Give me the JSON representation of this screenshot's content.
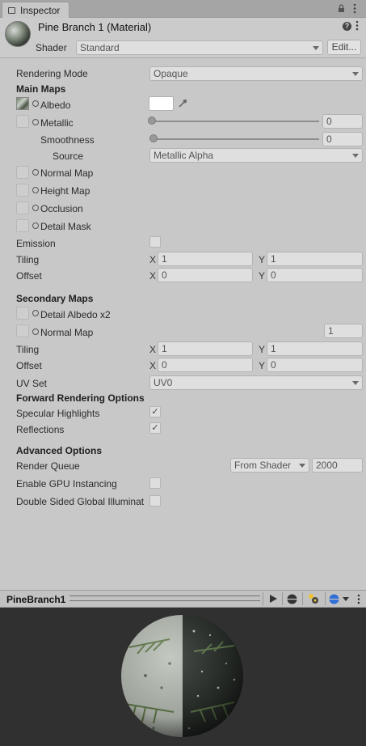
{
  "tab": {
    "title": "Inspector"
  },
  "header": {
    "material_name": "Pine Branch 1 (Material)",
    "shader_label": "Shader",
    "shader_value": "Standard",
    "edit_label": "Edit..."
  },
  "rendering_mode": {
    "label": "Rendering Mode",
    "value": "Opaque"
  },
  "main_maps": {
    "title": "Main Maps",
    "albedo": "Albedo",
    "metallic": {
      "label": "Metallic",
      "value": "0"
    },
    "smoothness": {
      "label": "Smoothness",
      "value": "0"
    },
    "source": {
      "label": "Source",
      "value": "Metallic Alpha"
    },
    "normal_map": "Normal Map",
    "height_map": "Height Map",
    "occlusion": "Occlusion",
    "detail_mask": "Detail Mask",
    "emission": "Emission",
    "tiling": {
      "label": "Tiling",
      "x": "1",
      "y": "1"
    },
    "offset": {
      "label": "Offset",
      "x": "0",
      "y": "0"
    }
  },
  "secondary_maps": {
    "title": "Secondary Maps",
    "detail_albedo": "Detail Albedo x2",
    "normal_map": {
      "label": "Normal Map",
      "value": "1"
    },
    "tiling": {
      "label": "Tiling",
      "x": "1",
      "y": "1"
    },
    "offset": {
      "label": "Offset",
      "x": "0",
      "y": "0"
    },
    "uv_set": {
      "label": "UV Set",
      "value": "UV0"
    }
  },
  "forward": {
    "title": "Forward Rendering Options",
    "specular": "Specular Highlights",
    "reflections": "Reflections"
  },
  "advanced": {
    "title": "Advanced Options",
    "render_queue": {
      "label": "Render Queue",
      "mode": "From Shader",
      "value": "2000"
    },
    "gpu_instancing": "Enable GPU Instancing",
    "double_sided": "Double Sided Global Illuminat"
  },
  "preview": {
    "title": "PineBranch1"
  },
  "axis": {
    "x": "X",
    "y": "Y"
  },
  "checks": {
    "on": "✓"
  },
  "colors": {
    "panel_bg": "#c8c8c8",
    "preview_bg": "#303030",
    "albedo_color": "#ffffff"
  }
}
